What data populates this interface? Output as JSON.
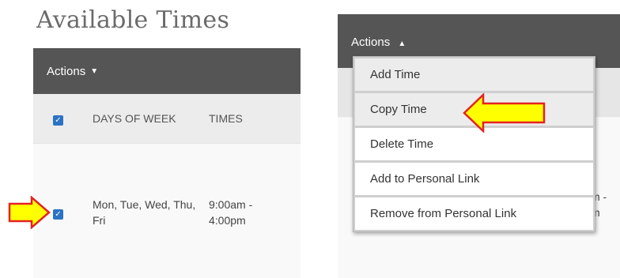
{
  "left": {
    "title": "Available Times",
    "actions_label": "Actions",
    "actions_caret": "▼",
    "columns": {
      "days": "DAYS OF WEEK",
      "times": "TIMES"
    },
    "row": {
      "days": "Mon, Tue, Wed, Thu, Fri",
      "times": "9:00am - 4:00pm"
    },
    "checkmark": "✓"
  },
  "right": {
    "actions_label": "Actions",
    "actions_caret": "▲",
    "partial_times": "m -\nm",
    "menu": [
      {
        "label": "Add Time"
      },
      {
        "label": "Copy Time"
      },
      {
        "label": "Delete Time"
      },
      {
        "label": "Add to Personal Link"
      },
      {
        "label": "Remove from Personal Link"
      }
    ]
  },
  "colors": {
    "actions_bar": "#555555",
    "checkbox": "#2b73c4",
    "arrow_fill": "#ffff00",
    "arrow_stroke": "#e52222"
  },
  "icons": [
    "checkbox-checked-icon",
    "caret-down-icon",
    "caret-up-icon",
    "yellow-arrow-icon"
  ]
}
